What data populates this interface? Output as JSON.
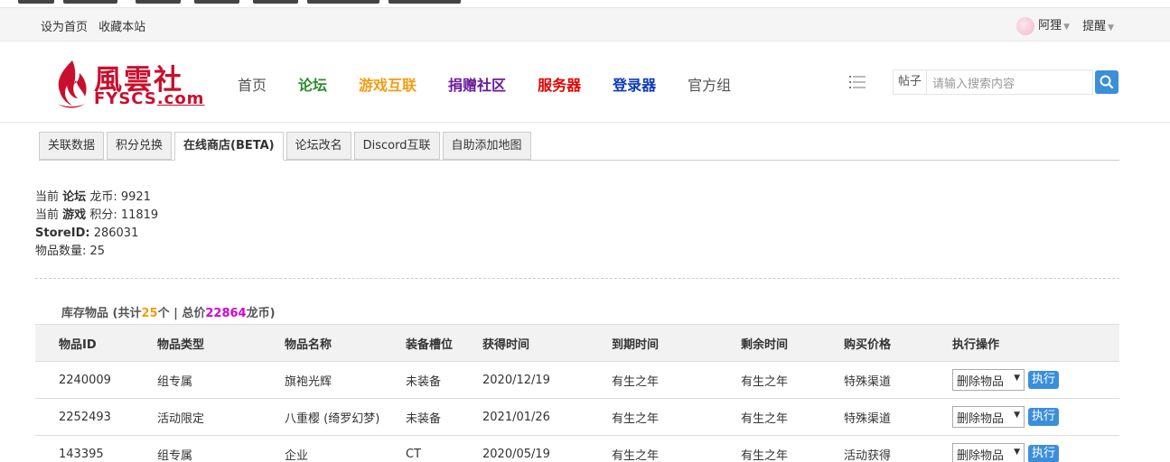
{
  "toplinks": {
    "set_home": "设为首页",
    "bookmark": "收藏本站",
    "username": "阿狸",
    "reminder": "提醒"
  },
  "logo": {
    "cn": "風雲社",
    "en": "FYSCS",
    "en_suffix": ".com"
  },
  "nav": [
    {
      "label": "首页",
      "color": "#555555"
    },
    {
      "label": "论坛",
      "color": "#2e8b2e"
    },
    {
      "label": "游戏互联",
      "color": "#f39c12"
    },
    {
      "label": "捐赠社区",
      "color": "#6a1b9a"
    },
    {
      "label": "服务器",
      "color": "#e00000"
    },
    {
      "label": "登录器",
      "color": "#0b3bb5"
    },
    {
      "label": "官方组",
      "color": "#555555"
    }
  ],
  "search": {
    "type": "帖子",
    "placeholder": "请输入搜索内容"
  },
  "tabs": [
    "关联数据",
    "积分兑换",
    "在线商店(BETA)",
    "论坛改名",
    "Discord互联",
    "自助添加地图"
  ],
  "info": {
    "prefix": "当前",
    "forum_label": "论坛",
    "coin_label": "龙币:",
    "coin_value": "9921",
    "game_label": "游戏",
    "points_label": "积分:",
    "points_value": "11819",
    "store_label": "StoreID:",
    "store_value": "286031",
    "items_label": "物品数量:",
    "items_value": "25"
  },
  "summary": {
    "prefix": "库存物品 (共计",
    "count": "25",
    "mid": "个 | 总价",
    "total": "22864",
    "suffix": "龙币)"
  },
  "table": {
    "headers": [
      "物品ID",
      "物品类型",
      "物品名称",
      "装备槽位",
      "获得时间",
      "到期时间",
      "剩余时间",
      "购买价格",
      "执行操作"
    ],
    "rows": [
      {
        "id": "2240009",
        "type": "组专属",
        "name": "旗袍光辉",
        "slot": "未装备",
        "got": "2020/12/19",
        "expire": "有生之年",
        "remain": "有生之年",
        "price": "特殊渠道",
        "action": "删除物品",
        "exec": "执行"
      },
      {
        "id": "2252493",
        "type": "活动限定",
        "name": "八重樱 (绮罗幻梦)",
        "slot": "未装备",
        "got": "2021/01/26",
        "expire": "有生之年",
        "remain": "有生之年",
        "price": "特殊渠道",
        "action": "删除物品",
        "exec": "执行"
      },
      {
        "id": "143395",
        "type": "组专属",
        "name": "企业",
        "slot": "CT",
        "got": "2020/05/19",
        "expire": "有生之年",
        "remain": "有生之年",
        "price": "活动获得",
        "action": "删除物品",
        "exec": "执行"
      }
    ]
  }
}
